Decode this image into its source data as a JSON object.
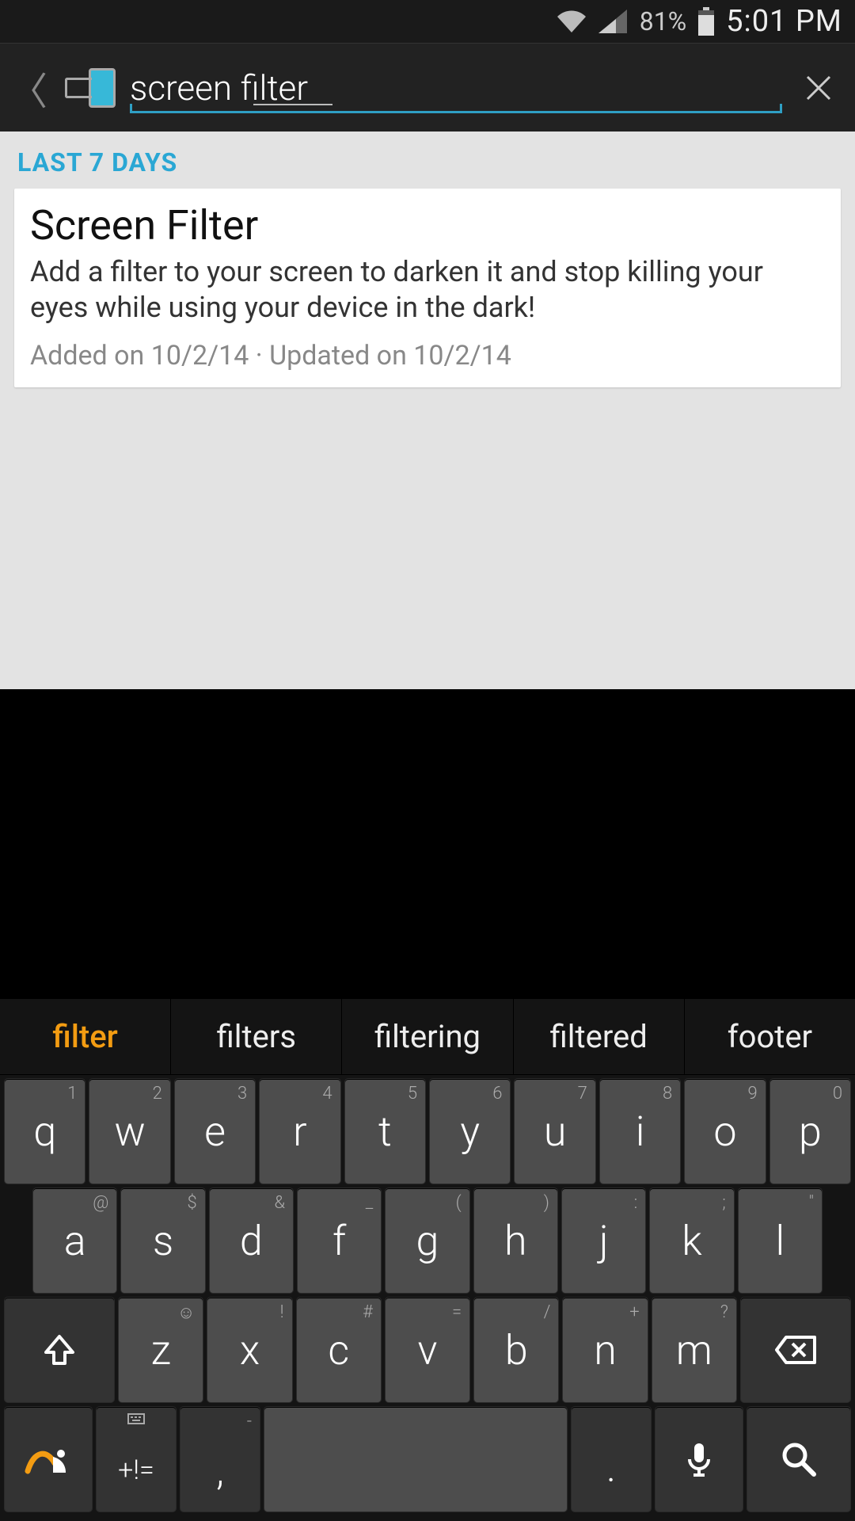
{
  "status": {
    "battery_pct": "81%",
    "time": "5:01 PM"
  },
  "search": {
    "value": "screen filter"
  },
  "section_label": "LAST 7 DAYS",
  "result": {
    "title": "Screen Filter",
    "description": "Add a filter to your screen to darken it and stop killing your eyes while using your device in the dark!",
    "meta": "Added on 10/2/14 · Updated on 10/2/14"
  },
  "suggestions": [
    "filter",
    "filters",
    "filtering",
    "filtered",
    "footer"
  ],
  "keys": {
    "row1": [
      {
        "m": "q",
        "s": "1"
      },
      {
        "m": "w",
        "s": "2"
      },
      {
        "m": "e",
        "s": "3"
      },
      {
        "m": "r",
        "s": "4"
      },
      {
        "m": "t",
        "s": "5"
      },
      {
        "m": "y",
        "s": "6"
      },
      {
        "m": "u",
        "s": "7"
      },
      {
        "m": "i",
        "s": "8"
      },
      {
        "m": "o",
        "s": "9"
      },
      {
        "m": "p",
        "s": "0"
      }
    ],
    "row2": [
      {
        "m": "a",
        "s": "@"
      },
      {
        "m": "s",
        "s": "$"
      },
      {
        "m": "d",
        "s": "&"
      },
      {
        "m": "f",
        "s": "_"
      },
      {
        "m": "g",
        "s": "("
      },
      {
        "m": "h",
        "s": ")"
      },
      {
        "m": "j",
        "s": ":"
      },
      {
        "m": "k",
        "s": ";"
      },
      {
        "m": "l",
        "s": "\""
      }
    ],
    "row3": [
      {
        "m": "z",
        "s": "☺"
      },
      {
        "m": "x",
        "s": "!"
      },
      {
        "m": "c",
        "s": "#"
      },
      {
        "m": "v",
        "s": "="
      },
      {
        "m": "b",
        "s": "/"
      },
      {
        "m": "n",
        "s": "+"
      },
      {
        "m": "m",
        "s": "?"
      }
    ],
    "sym_label": "+!=",
    "comma_main": ",",
    "comma_sup": "-",
    "period_main": "."
  }
}
